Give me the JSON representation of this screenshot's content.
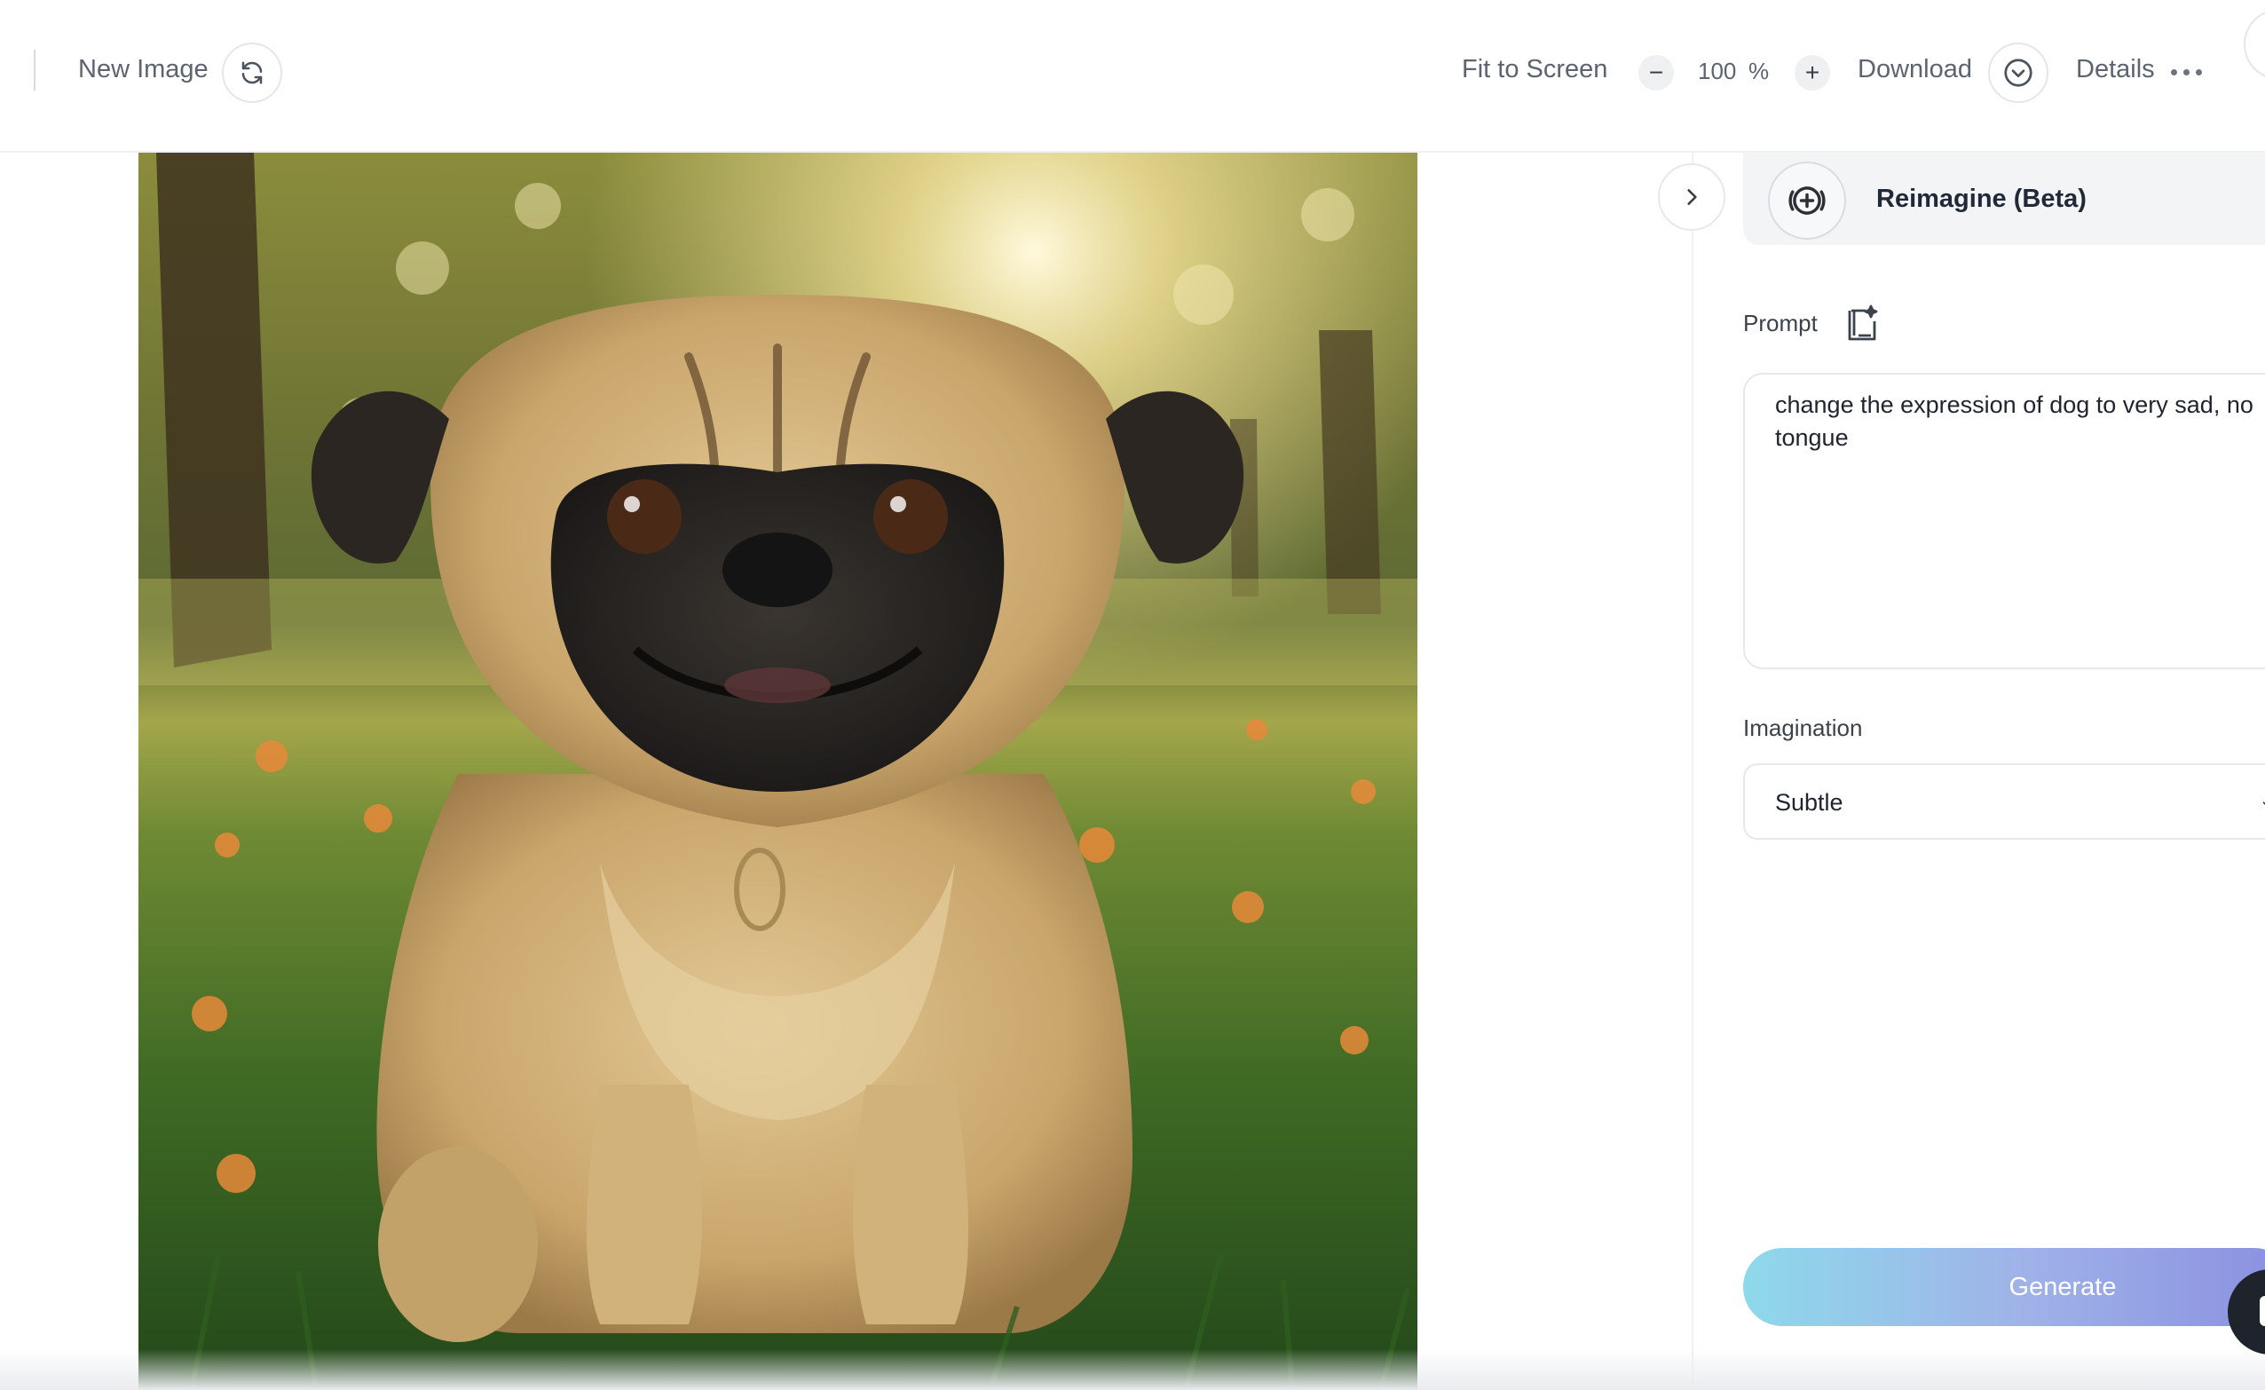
{
  "toolbar": {
    "new_image_label": "New Image",
    "new_image_icon": "refresh-icon",
    "fit_to_screen_label": "Fit to Screen",
    "zoom_out_symbol": "−",
    "zoom_value": "100",
    "zoom_unit": "%",
    "zoom_in_symbol": "+",
    "download_label": "Download",
    "download_icon": "chevron-down-circle-icon",
    "details_label": "Details",
    "details_icon": "more-horizontal-icon"
  },
  "canvas": {
    "image_subject": "pug-photo",
    "collapse_icon": "chevron-right-icon"
  },
  "panel": {
    "mode": {
      "icon": "add-circle-icon",
      "title": "Reimagine (Beta)",
      "chevron": "chevron-down-icon"
    },
    "prompt": {
      "label": "Prompt",
      "ai_icon": "sparkle-document-icon",
      "value": "change the expression of dog to very sad, no tongue"
    },
    "imagination": {
      "label": "Imagination",
      "selected": "Subtle"
    },
    "generate_label": "Generate"
  },
  "colors": {
    "accent_gradient_start": "#8ed9eb",
    "accent_gradient_end": "#8a8fe0",
    "text_primary": "#1f2937",
    "text_secondary": "#5b6470"
  }
}
